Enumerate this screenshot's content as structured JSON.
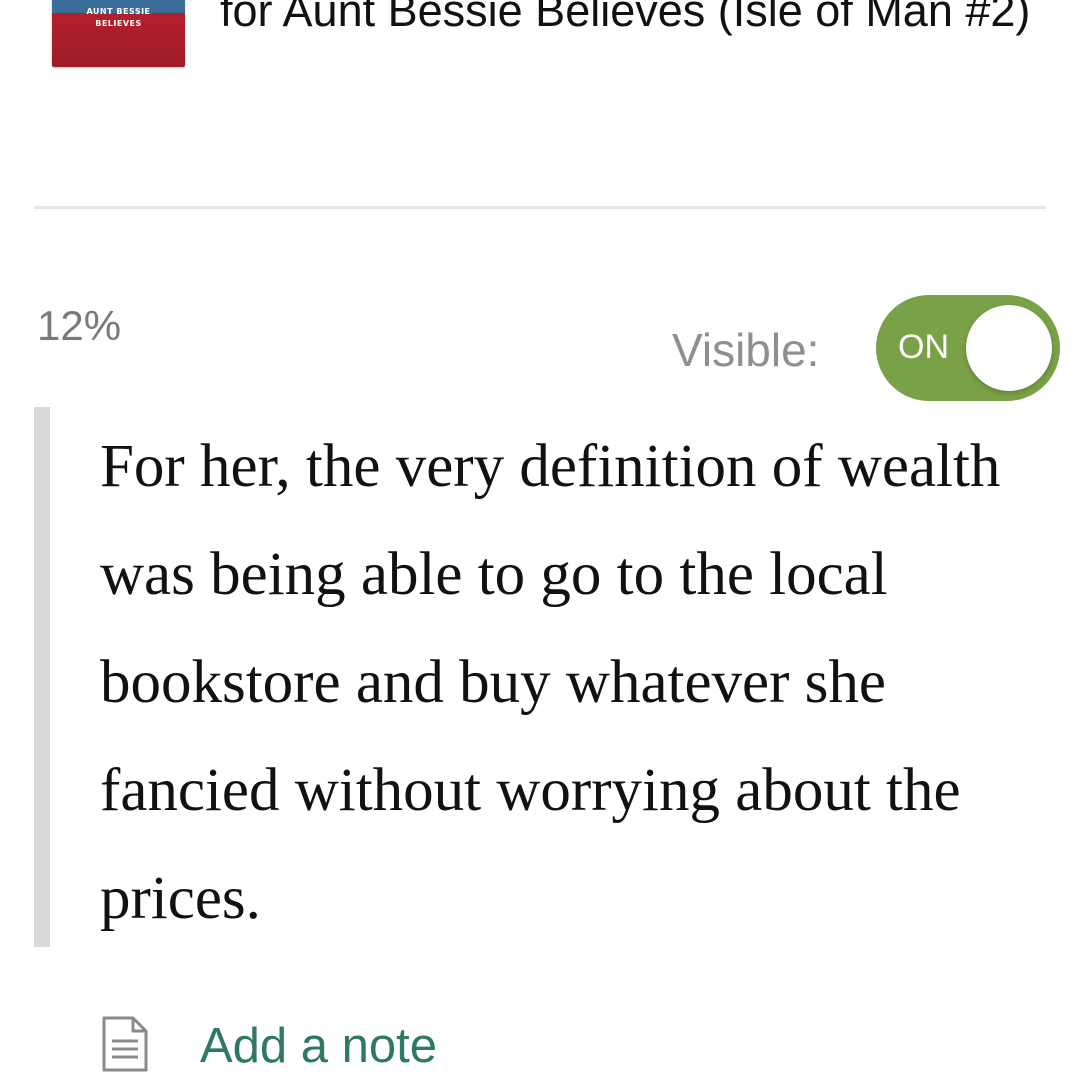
{
  "book": {
    "cover_line_1": "AUNT BESSIE",
    "cover_line_2": "BELIEVES",
    "title": "for Aunt Bessie Believes (Isle of Man #2)"
  },
  "progress": {
    "percent_label": "12%"
  },
  "visibility": {
    "label": "Visible:",
    "toggle_state": "ON",
    "toggle_color": "#78a148"
  },
  "highlight": {
    "text": "For her, the very definition of wealth was being able to go to the local bookstore and buy whatever she fancied without worrying about the prices."
  },
  "actions": {
    "add_note_label": "Add a note",
    "add_note_icon": "note-icon",
    "add_note_color": "#2e7866"
  }
}
